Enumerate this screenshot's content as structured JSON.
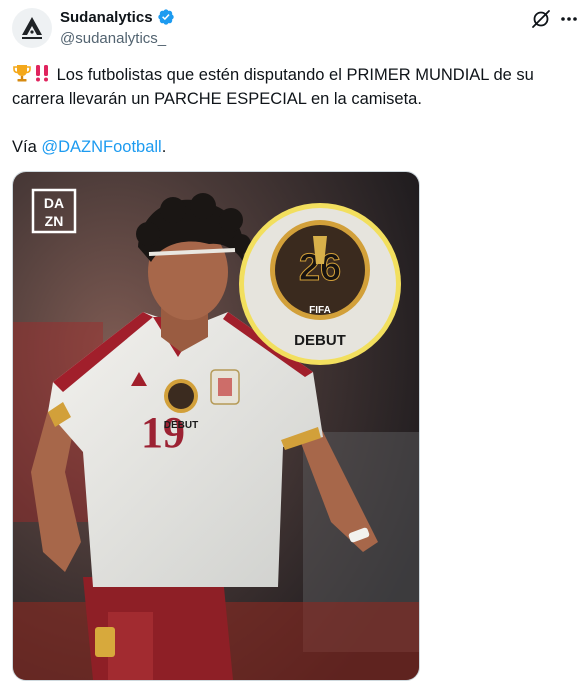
{
  "author": {
    "display_name": "Sudanalytics",
    "handle": "@sudanalytics_",
    "verified": true,
    "accent_color": "#1d9bf0"
  },
  "top_cut_text": "· · · · · · · · · · ·",
  "tweet": {
    "emoji_1": "trophy",
    "emoji_2": "double-exclamation",
    "text": "Los futbolistas que estén disputando el PRIMER MUNDIAL de su carrera llevarán un PARCHE ESPECIAL en la camiseta.",
    "via_prefix": "Vía ",
    "mention": "@DAZNFootball",
    "via_suffix": "."
  },
  "media": {
    "logo_top": "DA",
    "logo_bottom": "ZN",
    "patch_year": "26",
    "patch_fifa": "FIFA",
    "patch_label": "DEBUT",
    "shirt_number": "19",
    "chest_patch_label": "DEBUT"
  },
  "icons": {
    "grok": "grok-icon",
    "more": "more-icon",
    "verified": "verified-badge-icon"
  }
}
